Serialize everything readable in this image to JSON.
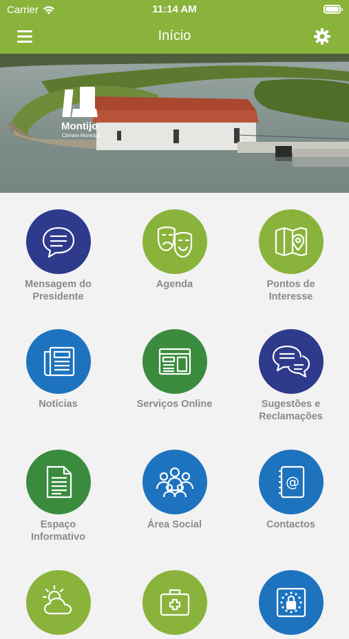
{
  "status": {
    "carrier": "Carrier",
    "time": "11:14 AM"
  },
  "nav": {
    "title": "Início",
    "menu_icon": "menu-icon",
    "settings_icon": "gear-icon"
  },
  "hero": {
    "logo_name": "Montijo",
    "logo_sub": "Câmara Municipal"
  },
  "colors": {
    "primary": "#8ab33b",
    "navy": "#2e3a8c",
    "blue": "#1e73be",
    "green": "#3a8b3e",
    "label": "#8a8a8a"
  },
  "tiles": [
    {
      "line1": "Mensagem do",
      "line2": "Presidente",
      "icon": "speech-bubble-icon",
      "color": "navy"
    },
    {
      "line1": "Agenda",
      "line2": "",
      "icon": "theater-masks-icon",
      "color": "lime"
    },
    {
      "line1": "Pontos de",
      "line2": "Interesse",
      "icon": "map-pin-icon",
      "color": "lime"
    },
    {
      "line1": "Notícias",
      "line2": "",
      "icon": "newspaper-icon",
      "color": "blue"
    },
    {
      "line1": "Serviços Online",
      "line2": "",
      "icon": "browser-window-icon",
      "color": "green"
    },
    {
      "line1": "Sugestões e",
      "line2": "Reclamações",
      "icon": "chat-bubbles-icon",
      "color": "navy"
    },
    {
      "line1": "Espaço",
      "line2": "Informativo",
      "icon": "document-icon",
      "color": "green"
    },
    {
      "line1": "Área Social",
      "line2": "",
      "icon": "people-group-icon",
      "color": "blue"
    },
    {
      "line1": "Contactos",
      "line2": "",
      "icon": "address-book-icon",
      "color": "blue"
    },
    {
      "line1": "",
      "line2": "",
      "icon": "weather-icon",
      "color": "lime"
    },
    {
      "line1": "",
      "line2": "",
      "icon": "first-aid-kit-icon",
      "color": "lime"
    },
    {
      "line1": "",
      "line2": "",
      "icon": "eu-lock-icon",
      "color": "blue"
    }
  ]
}
